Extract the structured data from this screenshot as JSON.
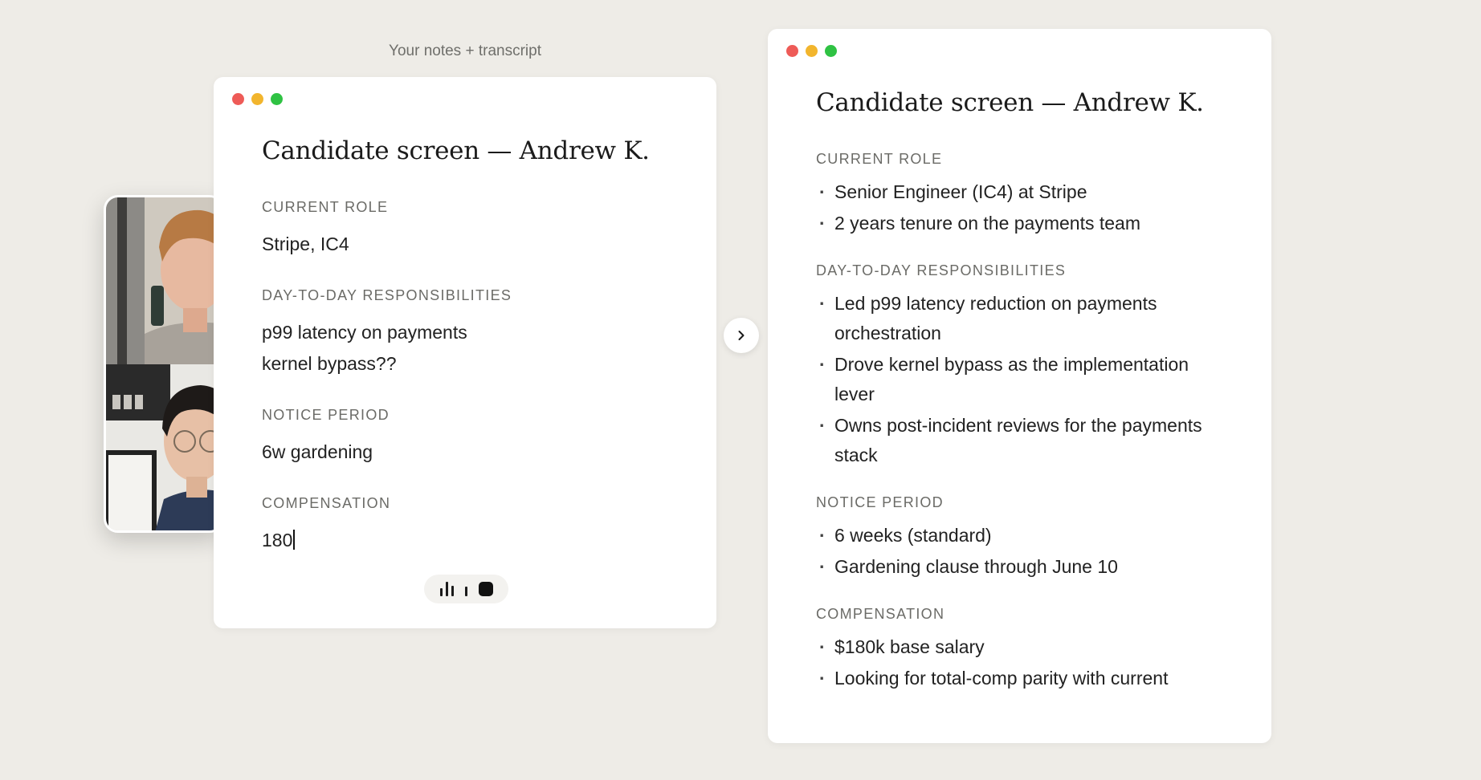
{
  "caption": "Your notes + transcript",
  "video_call": {
    "participants": [
      "participant-1-video",
      "participant-2-video"
    ]
  },
  "notes_window": {
    "title": "Candidate screen — Andrew K.",
    "sections": [
      {
        "label": "CURRENT ROLE",
        "lines": [
          "Stripe, IC4"
        ]
      },
      {
        "label": "DAY-TO-DAY RESPONSIBILITIES",
        "lines": [
          "p99 latency on payments",
          "kernel bypass??"
        ]
      },
      {
        "label": "NOTICE PERIOD",
        "lines": [
          "6w gardening"
        ]
      },
      {
        "label": "COMPENSATION",
        "lines": [
          "180"
        ]
      }
    ],
    "recorder": {
      "wave_icon": "audio-wave-icon",
      "stop_icon": "stop-icon"
    }
  },
  "arrow_icon": "chevron-right-icon",
  "enhanced_window": {
    "title": "Candidate screen — Andrew K.",
    "sections": [
      {
        "label": "CURRENT ROLE",
        "bullets": [
          "Senior Engineer (IC4) at Stripe",
          "2 years tenure on the payments team"
        ]
      },
      {
        "label": "DAY-TO-DAY RESPONSIBILITIES",
        "bullets": [
          "Led p99 latency reduction on payments orchestration",
          "Drove kernel bypass as the implementation lever",
          "Owns post-incident reviews for the payments stack"
        ]
      },
      {
        "label": "NOTICE PERIOD",
        "bullets": [
          "6 weeks (standard)",
          "Gardening clause through June 10"
        ]
      },
      {
        "label": "COMPENSATION",
        "bullets": [
          "$180k base salary",
          "Looking for total-comp parity with current"
        ]
      }
    ]
  },
  "colors": {
    "background": "#eeece7",
    "window_red": "#ee5b57",
    "window_yellow": "#f2b52d",
    "window_green": "#2fc243"
  }
}
